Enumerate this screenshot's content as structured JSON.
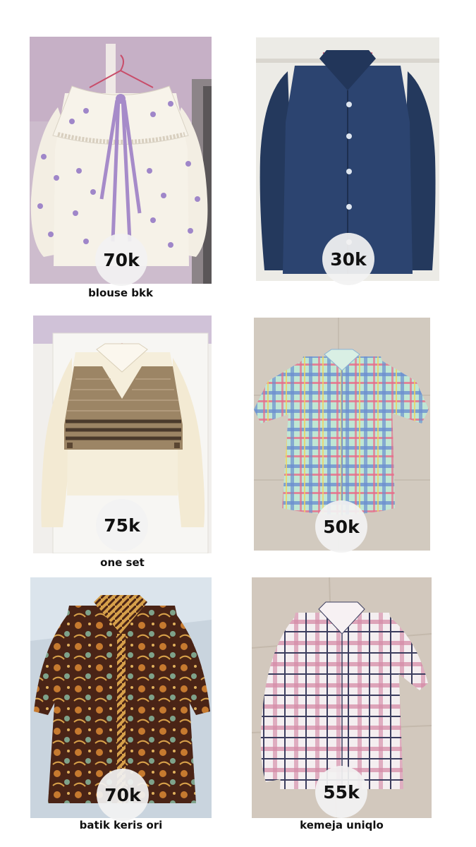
{
  "products": [
    {
      "caption": "blouse bkk",
      "price": "70k",
      "image": "white floral blouse with purple ribbon ties on hanger"
    },
    {
      "caption": "",
      "price": "30k",
      "image": "navy blue long sleeve button shirt on hanger"
    },
    {
      "caption": "one set",
      "price": "75k",
      "image": "cream shirt with striped brown knit vest"
    },
    {
      "caption": "",
      "price": "50k",
      "image": "short sleeve plaid shirt laid flat on floor"
    },
    {
      "caption": "batik keris ori",
      "price": "70k",
      "image": "brown batik long sleeve shirt laid flat"
    },
    {
      "caption": "kemeja uniqlo",
      "price": "55k",
      "image": "pink and white plaid flannel shirt laid flat"
    }
  ],
  "colors": {
    "background": "#ffffff",
    "price_badge": "#f2f2f2",
    "text": "#111111"
  }
}
